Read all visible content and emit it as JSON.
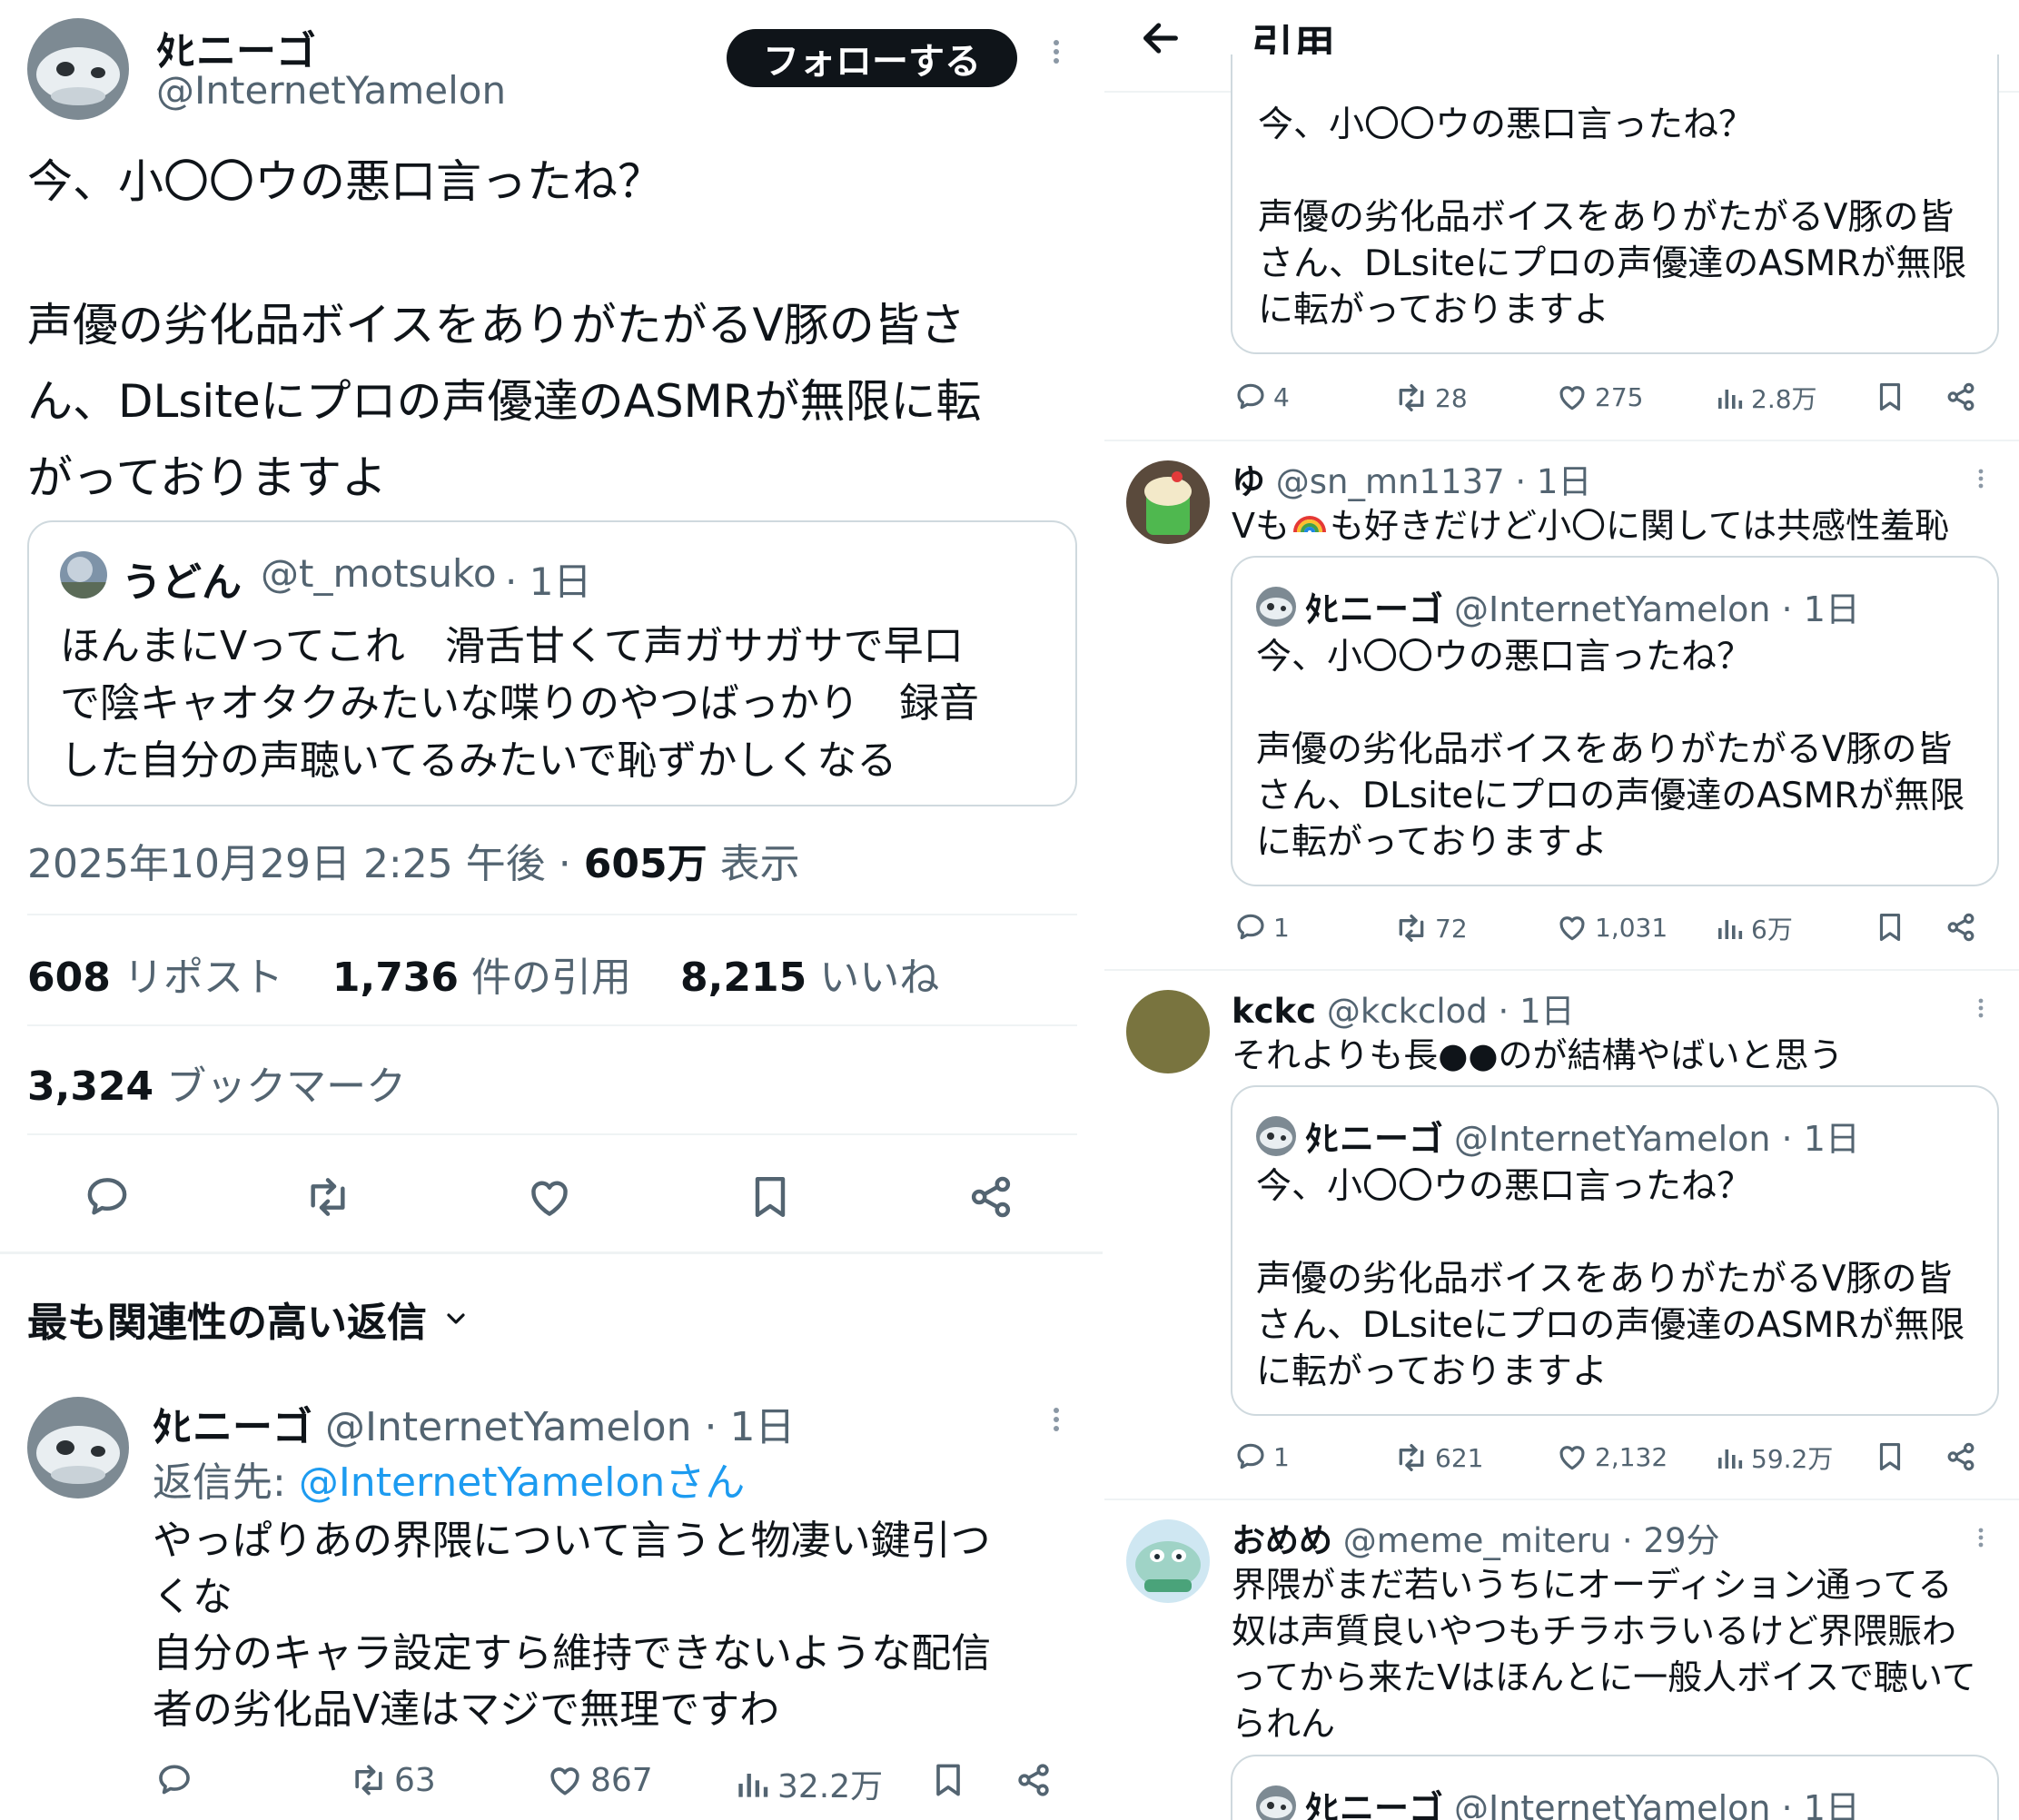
{
  "main_tweet": {
    "author_name": "ﾀﾋニーゴ",
    "author_handle": "@InternetYamelon",
    "follow_button": "フォローする",
    "text_line1": "今、小〇〇ウの悪口言ったね？",
    "text_line2": "声優の劣化品ボイスをありがたがるV豚の皆さ",
    "text_line3": "ん、DLsiteにプロの声優達のASMRが無限に転",
    "text_line4": "がっておりますよ",
    "quoted": {
      "author_name": "うどん",
      "author_handle": "@t_motsuko",
      "time": "· 1日",
      "line1": "ほんまにVってこれ　滑舌甘くて声ガサガサで早口",
      "line2": "で陰キャオタクみたいな喋りのやつばっかり　録音",
      "line3": "した自分の声聴いてるみたいで恥ずかしくなる"
    },
    "timestamp": "2025年10月29日 2:25 午後 ·",
    "views_count": "605万",
    "views_label": "表示",
    "reposts_count": "608",
    "reposts_label": "リポスト",
    "quotes_count": "1,736",
    "quotes_label": "件の引用",
    "likes_count": "8,215",
    "likes_label": "いいね",
    "bookmarks_count": "3,324",
    "bookmarks_label": "ブックマーク"
  },
  "replies_header": "最も関連性の高い返信",
  "reply": {
    "author_name": "ﾀﾋニーゴ",
    "author_handle": "@InternetYamelon",
    "time": "· 1日",
    "reply_to_label": "返信先:",
    "reply_to_handle": "@InternetYamelonさん",
    "line1": "やっぱりあの界隈について言うと物凄い鍵引つ",
    "line2": "くな",
    "line3": "自分のキャラ設定すら維持できないような配信",
    "line4": "者の劣化品V達はマジで無理ですわ",
    "retweets": "63",
    "likes": "867",
    "views": "32.2万"
  },
  "right_header": {
    "title": "引用"
  },
  "quote_tweet_text": {
    "line1": "今、小〇〇ウの悪口言ったね？",
    "line2": "声優の劣化品ボイスをありがたがるV豚の皆",
    "line3": "さん、DLsiteにプロの声優達のASMRが無限",
    "line4": "に転がっておりますよ"
  },
  "first_quote_stats": {
    "replies": "4",
    "retweets": "28",
    "likes": "275",
    "views": "2.8万"
  },
  "quotes": [
    {
      "author_name": "ゆ",
      "author_handle": "@sn_mn1137 · 1日",
      "text_line1_pre": "Vも",
      "text_line1_post": "も好きだけど小〇に関しては共感性羞恥",
      "embedded_name": "ﾀﾋニーゴ",
      "embedded_handle": "@InternetYamelon · 1日",
      "replies": "1",
      "retweets": "72",
      "likes": "1,031",
      "views": "6万"
    },
    {
      "author_name": "kckc",
      "author_handle": "@kckclod · 1日",
      "text_line1": "それよりも長●●のが結構やばいと思う",
      "embedded_name": "ﾀﾋニーゴ",
      "embedded_handle": "@InternetYamelon · 1日",
      "replies": "1",
      "retweets": "621",
      "likes": "2,132",
      "views": "59.2万"
    },
    {
      "author_name": "おめめ",
      "author_handle": "@meme_miteru · 29分",
      "text_line1": "界隈がまだ若いうちにオーディション通ってる",
      "text_line2": "奴は声質良いやつもチラホラいるけど界隈賑わ",
      "text_line3": "ってから来たVはほんとに一般人ボイスで聴いて",
      "text_line4": "られん",
      "embedded_name": "ﾀﾋニーゴ",
      "embedded_handle": "@InternetYamelon · 1日"
    }
  ],
  "colors": {
    "accent": "#1d9bf0",
    "muted": "#536471",
    "border": "#cfd9de",
    "divider": "#eff3f4"
  }
}
